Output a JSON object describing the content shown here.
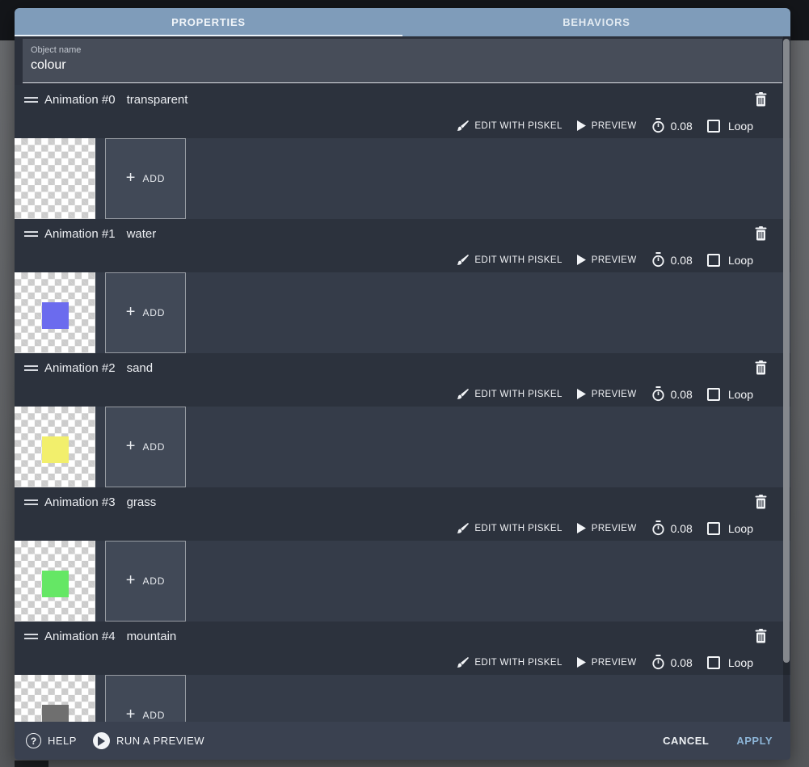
{
  "tabs": {
    "properties": "PROPERTIES",
    "behaviors": "BEHAVIORS"
  },
  "object_name": {
    "label": "Object name",
    "value": "colour"
  },
  "controls": {
    "edit_label": "EDIT WITH PISKEL",
    "preview_label": "PREVIEW",
    "loop_label": "Loop",
    "add_plus": "+",
    "add_label": "ADD"
  },
  "animations": [
    {
      "index_label": "Animation #0",
      "name": "transparent",
      "delay": "0.08",
      "loop_checked": false,
      "swatch": null
    },
    {
      "index_label": "Animation #1",
      "name": "water",
      "delay": "0.08",
      "loop_checked": false,
      "swatch": "#6b6bee"
    },
    {
      "index_label": "Animation #2",
      "name": "sand",
      "delay": "0.08",
      "loop_checked": false,
      "swatch": "#f2ef6c"
    },
    {
      "index_label": "Animation #3",
      "name": "grass",
      "delay": "0.08",
      "loop_checked": false,
      "swatch": "#65e765"
    },
    {
      "index_label": "Animation #4",
      "name": "mountain",
      "delay": "0.08",
      "loop_checked": false,
      "swatch": "#6f6f6f"
    }
  ],
  "footer": {
    "help": "HELP",
    "run_preview": "RUN A PREVIEW",
    "cancel": "CANCEL",
    "apply": "APPLY"
  },
  "help_qmark": "?",
  "colors": {
    "tab_bar": "#7f9cba",
    "apply_accent": "#8cb4d6",
    "dialog_bg": "#2b303b",
    "header_bg": "#2c323d",
    "thumb_row_bg": "#353c49"
  }
}
